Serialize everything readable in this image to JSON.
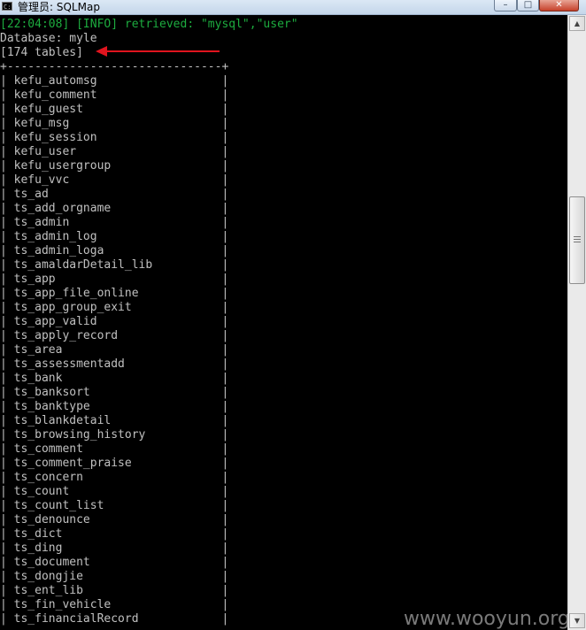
{
  "window": {
    "title": "管理员: SQLMap",
    "icon_label": "C:\\",
    "controls": {
      "minimize": "–",
      "maximize": "□",
      "close": "✕"
    }
  },
  "console": {
    "info_line": "[22:04:08] [INFO] retrieved: \"mysql\",\"user\"",
    "database_line": "Database: myle",
    "count_line": "[174 tables]",
    "border_line": "+-------------------------------+",
    "tables": [
      "kefu_automsg",
      "kefu_comment",
      "kefu_guest",
      "kefu_msg",
      "kefu_session",
      "kefu_user",
      "kefu_usergroup",
      "kefu_vvc",
      "ts_ad",
      "ts_add_orgname",
      "ts_admin",
      "ts_admin_log",
      "ts_admin_loga",
      "ts_amaldarDetail_lib",
      "ts_app",
      "ts_app_file_online",
      "ts_app_group_exit",
      "ts_app_valid",
      "ts_apply_record",
      "ts_area",
      "ts_assessmentadd",
      "ts_bank",
      "ts_banksort",
      "ts_banktype",
      "ts_blankdetail",
      "ts_browsing_history",
      "ts_comment",
      "ts_comment_praise",
      "ts_concern",
      "ts_count",
      "ts_count_list",
      "ts_denounce",
      "ts_dict",
      "ts_ding",
      "ts_document",
      "ts_dongjie",
      "ts_ent_lib",
      "ts_fin_vehicle",
      "ts_financialRecord"
    ]
  },
  "watermark": "www.wooyun.org",
  "colors": {
    "console_bg": "#000000",
    "console_text": "#c0c0c0",
    "info_text": "#1dac3f",
    "arrow": "#e0141e"
  },
  "icons": {
    "arrow": "left-arrow-icon",
    "scroll_up": "scroll-up-arrow-icon",
    "scroll_down": "scroll-down-arrow-icon"
  }
}
